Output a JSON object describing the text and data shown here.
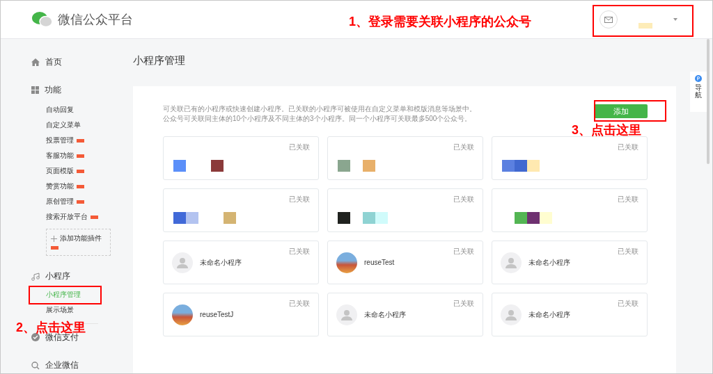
{
  "header": {
    "brand": "微信公众平台"
  },
  "sidebar": {
    "sections": [
      {
        "label": "首页"
      },
      {
        "label": "功能",
        "items": [
          {
            "label": "自动回复",
            "new": false,
            "selected": false
          },
          {
            "label": "自定义菜单",
            "new": false,
            "selected": false
          },
          {
            "label": "投票管理",
            "new": true,
            "selected": false
          },
          {
            "label": "客服功能",
            "new": true,
            "selected": false
          },
          {
            "label": "页面模版",
            "new": true,
            "selected": false
          },
          {
            "label": "赞赏功能",
            "new": true,
            "selected": false
          },
          {
            "label": "原创管理",
            "new": true,
            "selected": false
          },
          {
            "label": "搜索开放平台",
            "new": true,
            "selected": false
          }
        ],
        "plugin": {
          "label": "添加功能插件",
          "new": true
        }
      },
      {
        "label": "小程序",
        "items": [
          {
            "label": "小程序管理",
            "new": false,
            "selected": true
          },
          {
            "label": "展示场景",
            "new": false,
            "selected": false
          }
        ]
      },
      {
        "label": "微信支付"
      },
      {
        "label": "企业微信"
      }
    ]
  },
  "page": {
    "title": "小程序管理",
    "description": [
      "可关联已有的小程序或快速创建小程序。已关联的小程序可被使用在自定义菜单和模版消息等场景中。",
      "公众号可关联同主体的10个小程序及不同主体的3个小程序。同一个小程序可关联最多500个公众号。"
    ],
    "add_button": "添加",
    "cards": [
      {
        "kind": "redacted",
        "status": "已关联"
      },
      {
        "kind": "redacted",
        "status": "已关联"
      },
      {
        "kind": "redacted",
        "status": "已关联"
      },
      {
        "kind": "redacted",
        "status": "已关联"
      },
      {
        "kind": "redacted",
        "status": "已关联"
      },
      {
        "kind": "redacted",
        "status": "已关联"
      },
      {
        "kind": "app",
        "status": "已关联",
        "name": "未命名小程序",
        "photo": false
      },
      {
        "kind": "app",
        "status": "已关联",
        "name": "reuseTest",
        "photo": true
      },
      {
        "kind": "app",
        "status": "已关联",
        "name": "未命名小程序",
        "photo": false
      },
      {
        "kind": "app",
        "status": "已关联",
        "name": "reuseTestJ",
        "photo": true
      },
      {
        "kind": "app",
        "status": "已关联",
        "name": "未命名小程序",
        "photo": false
      },
      {
        "kind": "app",
        "status": "已关联",
        "name": "未命名小程序",
        "photo": false
      }
    ]
  },
  "float_nav": {
    "label": "导航"
  },
  "annotations": [
    "1、登录需要关联小程序的公众号",
    "2、点击这里",
    "3、点击这里"
  ]
}
